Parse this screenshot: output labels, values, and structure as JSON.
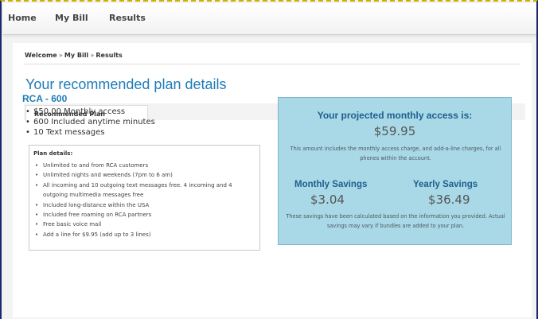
{
  "nav": {
    "items": [
      {
        "label": "Home"
      },
      {
        "label": "My Bill"
      },
      {
        "label": "Results"
      }
    ]
  },
  "breadcrumb": {
    "items": [
      "Welcome",
      "My Bill",
      "Results"
    ],
    "separator": "»"
  },
  "page_title": "Your recommended plan details",
  "tab": {
    "label": "Recommended Plan"
  },
  "plan": {
    "name": "RCA - 600",
    "features": [
      "$50.00 Monthly access",
      "600 Included anytime minutes",
      "10 Text messages"
    ]
  },
  "plan_details": {
    "title": "Plan details:",
    "items": [
      "Unlimited to and from RCA customers",
      "Unlimited nights and weekends (7pm to 6 am)",
      "All incoming and 10 outgoing text messages free. 4 incoming and 4 outgoing multimedia messages free",
      "Included long-distance within the USA",
      "Included free roaming on RCA partners",
      "Free basic voice mail",
      "Add a line for $9.95 (add up to 3 lines)"
    ]
  },
  "projection": {
    "label": "Your projected monthly access is:",
    "value": "$59.95",
    "note": "This amount includes the monthly access charge, and add-a-line charges, for all phones within the account."
  },
  "savings": {
    "monthly_label": "Monthly Savings",
    "monthly_value": "$3.04",
    "yearly_label": "Yearly Savings",
    "yearly_value": "$36.49",
    "note": "These savings have been calculated based on the information you provided. Actual savings may vary if bundles are added to your plan."
  },
  "colors": {
    "accent": "#1e7cb8",
    "savings_panel": "#a9d8e6",
    "savings_heading": "#1e5f8e"
  }
}
